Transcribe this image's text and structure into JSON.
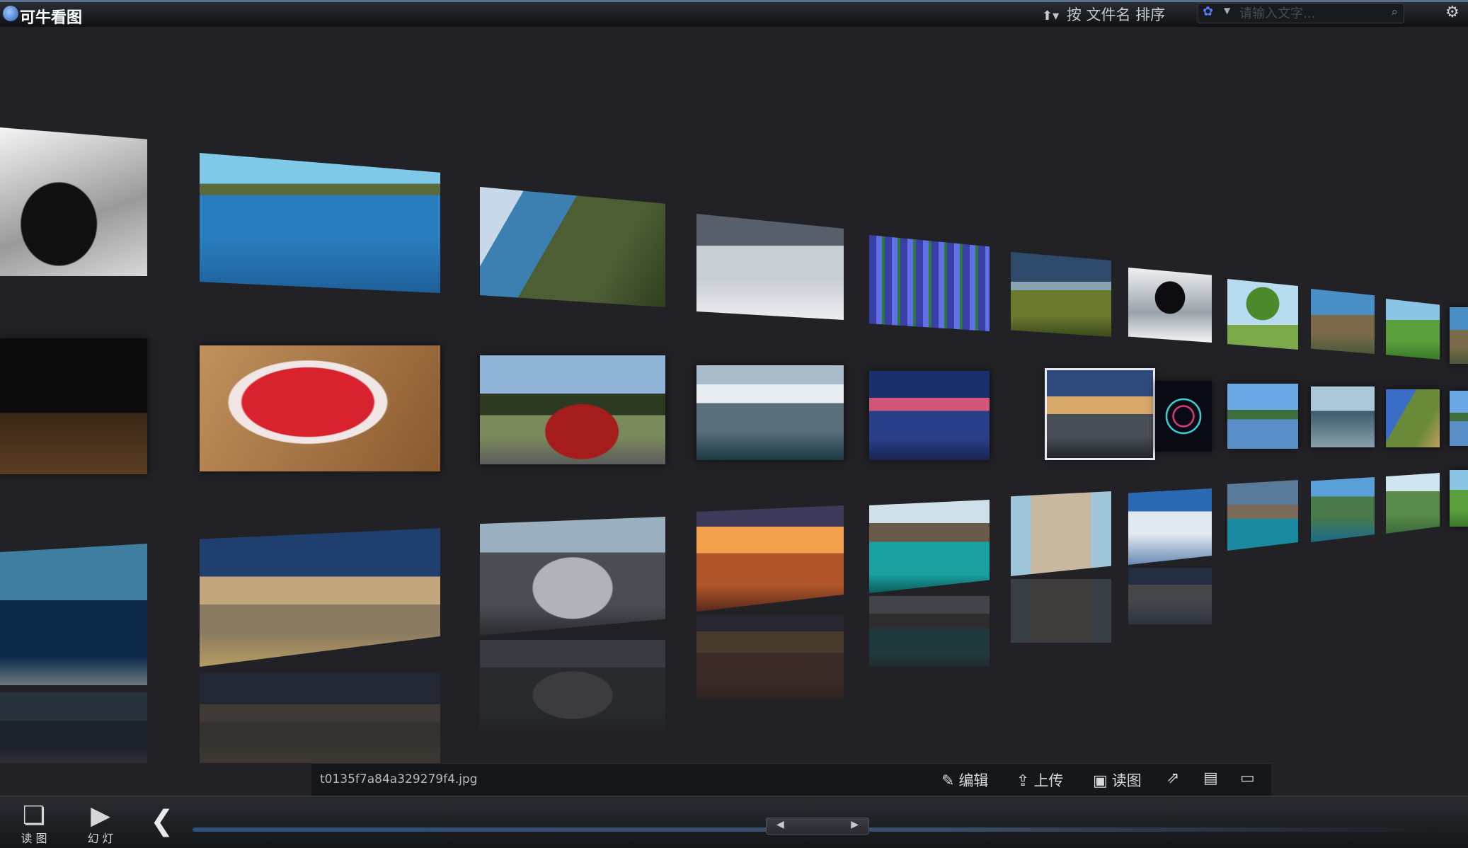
{
  "titlebar": {
    "app_title": "可牛看图",
    "sort_label": "按 文件名 排序",
    "search_placeholder": "请输入文字..."
  },
  "infobar": {
    "file_name": "t0135f7a84a329279f4.jpg",
    "edit_label": "编辑",
    "upload_label": "上传",
    "read_label": "读图"
  },
  "bottombar": {
    "read_label": "读 图",
    "slideshow_label": "幻 灯"
  },
  "thumbnails": [
    "sports car black and white",
    "infinity pool ocean",
    "coastal cliffs",
    "mountains above fog",
    "purple grape hyacinth flowers",
    "farm field path",
    "snowy peak",
    "lone tree",
    "valley",
    "green meadow",
    "dark room floor",
    "fruit heart bowl",
    "red supercar",
    "snow mountains lake",
    "pink sunset lake",
    "mountain clouds sunset",
    "neon ring",
    "lake reflection",
    "wooden pier",
    "coastline cliff",
    "underwater",
    "beach dusk",
    "silver sports car",
    "sunset above clouds",
    "turquoise fjord",
    "flatiron building",
    "matterhorn snow",
    "alpine lakes",
    "mountain lake",
    "green hills"
  ]
}
